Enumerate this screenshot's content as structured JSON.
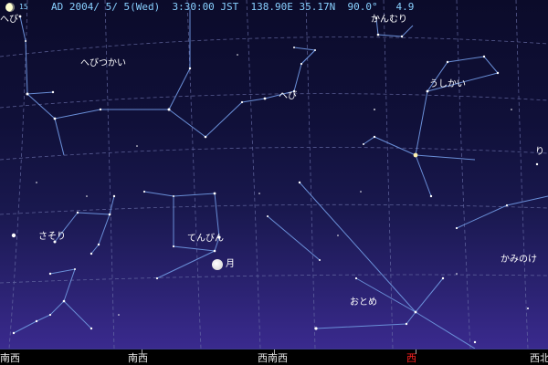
{
  "status": {
    "moon_age": "15",
    "text": "AD 2004/ 5/ 5(Wed)  3:30:00 JST  138.90E 35.17N  90.0°   4.9"
  },
  "constellations": {
    "hebitsukai": "へびつかい",
    "hebi_right": "へび",
    "hebi_left": "へび",
    "kanmuri": "かんむり",
    "ushikai": "うしかい",
    "sasori": "さそり",
    "tenbin": "てんびん",
    "otome": "おとめ",
    "kaminoke": "かみのけ",
    "ri": "り"
  },
  "moon_label": "月",
  "directions": {
    "d1": "南西",
    "d2": "南西",
    "d3": "西南西",
    "d4": "西",
    "d5": "西北"
  },
  "colors": {
    "west_highlight": "#ff2020",
    "constellation_line": "#6a8fd8",
    "grid_line": "#6a6fa8"
  }
}
